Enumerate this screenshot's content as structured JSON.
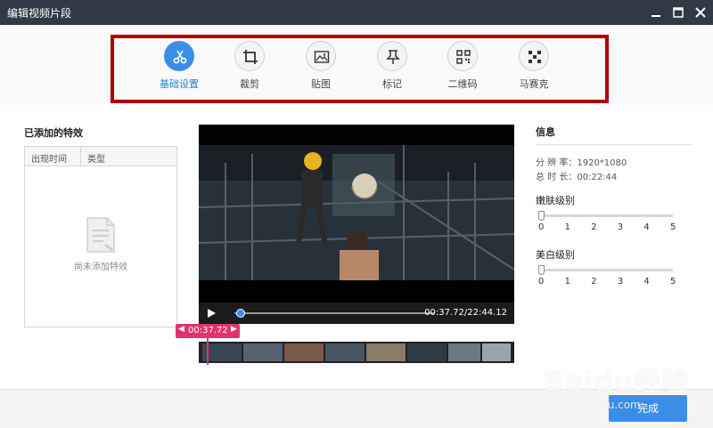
{
  "window": {
    "title": "编辑视频片段"
  },
  "toolbar": {
    "tools": [
      {
        "label": "基础设置",
        "icon": "scissors-icon",
        "active": true
      },
      {
        "label": "裁剪",
        "icon": "crop-icon",
        "active": false
      },
      {
        "label": "贴图",
        "icon": "image-icon",
        "active": false
      },
      {
        "label": "标记",
        "icon": "pin-icon",
        "active": false
      },
      {
        "label": "二维码",
        "icon": "qrcode-icon",
        "active": false
      },
      {
        "label": "马赛克",
        "icon": "mosaic-icon",
        "active": false
      }
    ]
  },
  "effects": {
    "title": "已添加的特效",
    "columns": [
      "出现时间",
      "类型"
    ],
    "empty_text": "尚未添加特效"
  },
  "player": {
    "time_display": "00:37.72/22:44.12",
    "progress": 0.03,
    "timeline_tag": "00:37.72"
  },
  "info": {
    "title": "信息",
    "resolution_label": "分 辨 率：",
    "resolution_value": "1920*1080",
    "duration_label": "总 时 长：",
    "duration_value": "00:22:44"
  },
  "smooth": {
    "label": "嫩肤级别",
    "ticks": [
      "0",
      "1",
      "2",
      "3",
      "4",
      "5"
    ],
    "value": 0
  },
  "whiten": {
    "label": "美白级别",
    "ticks": [
      "0",
      "1",
      "2",
      "3",
      "4",
      "5"
    ],
    "value": 0
  },
  "footer": {
    "done_label": "完成"
  },
  "watermark": {
    "main": "Baidu经验",
    "sub": "jingyan.baidu.com"
  },
  "colors": {
    "accent": "#3a8ee6",
    "highlight_frame": "#b00000",
    "timeline_tag": "#e0336e",
    "titlebar": "#2f3a46"
  }
}
